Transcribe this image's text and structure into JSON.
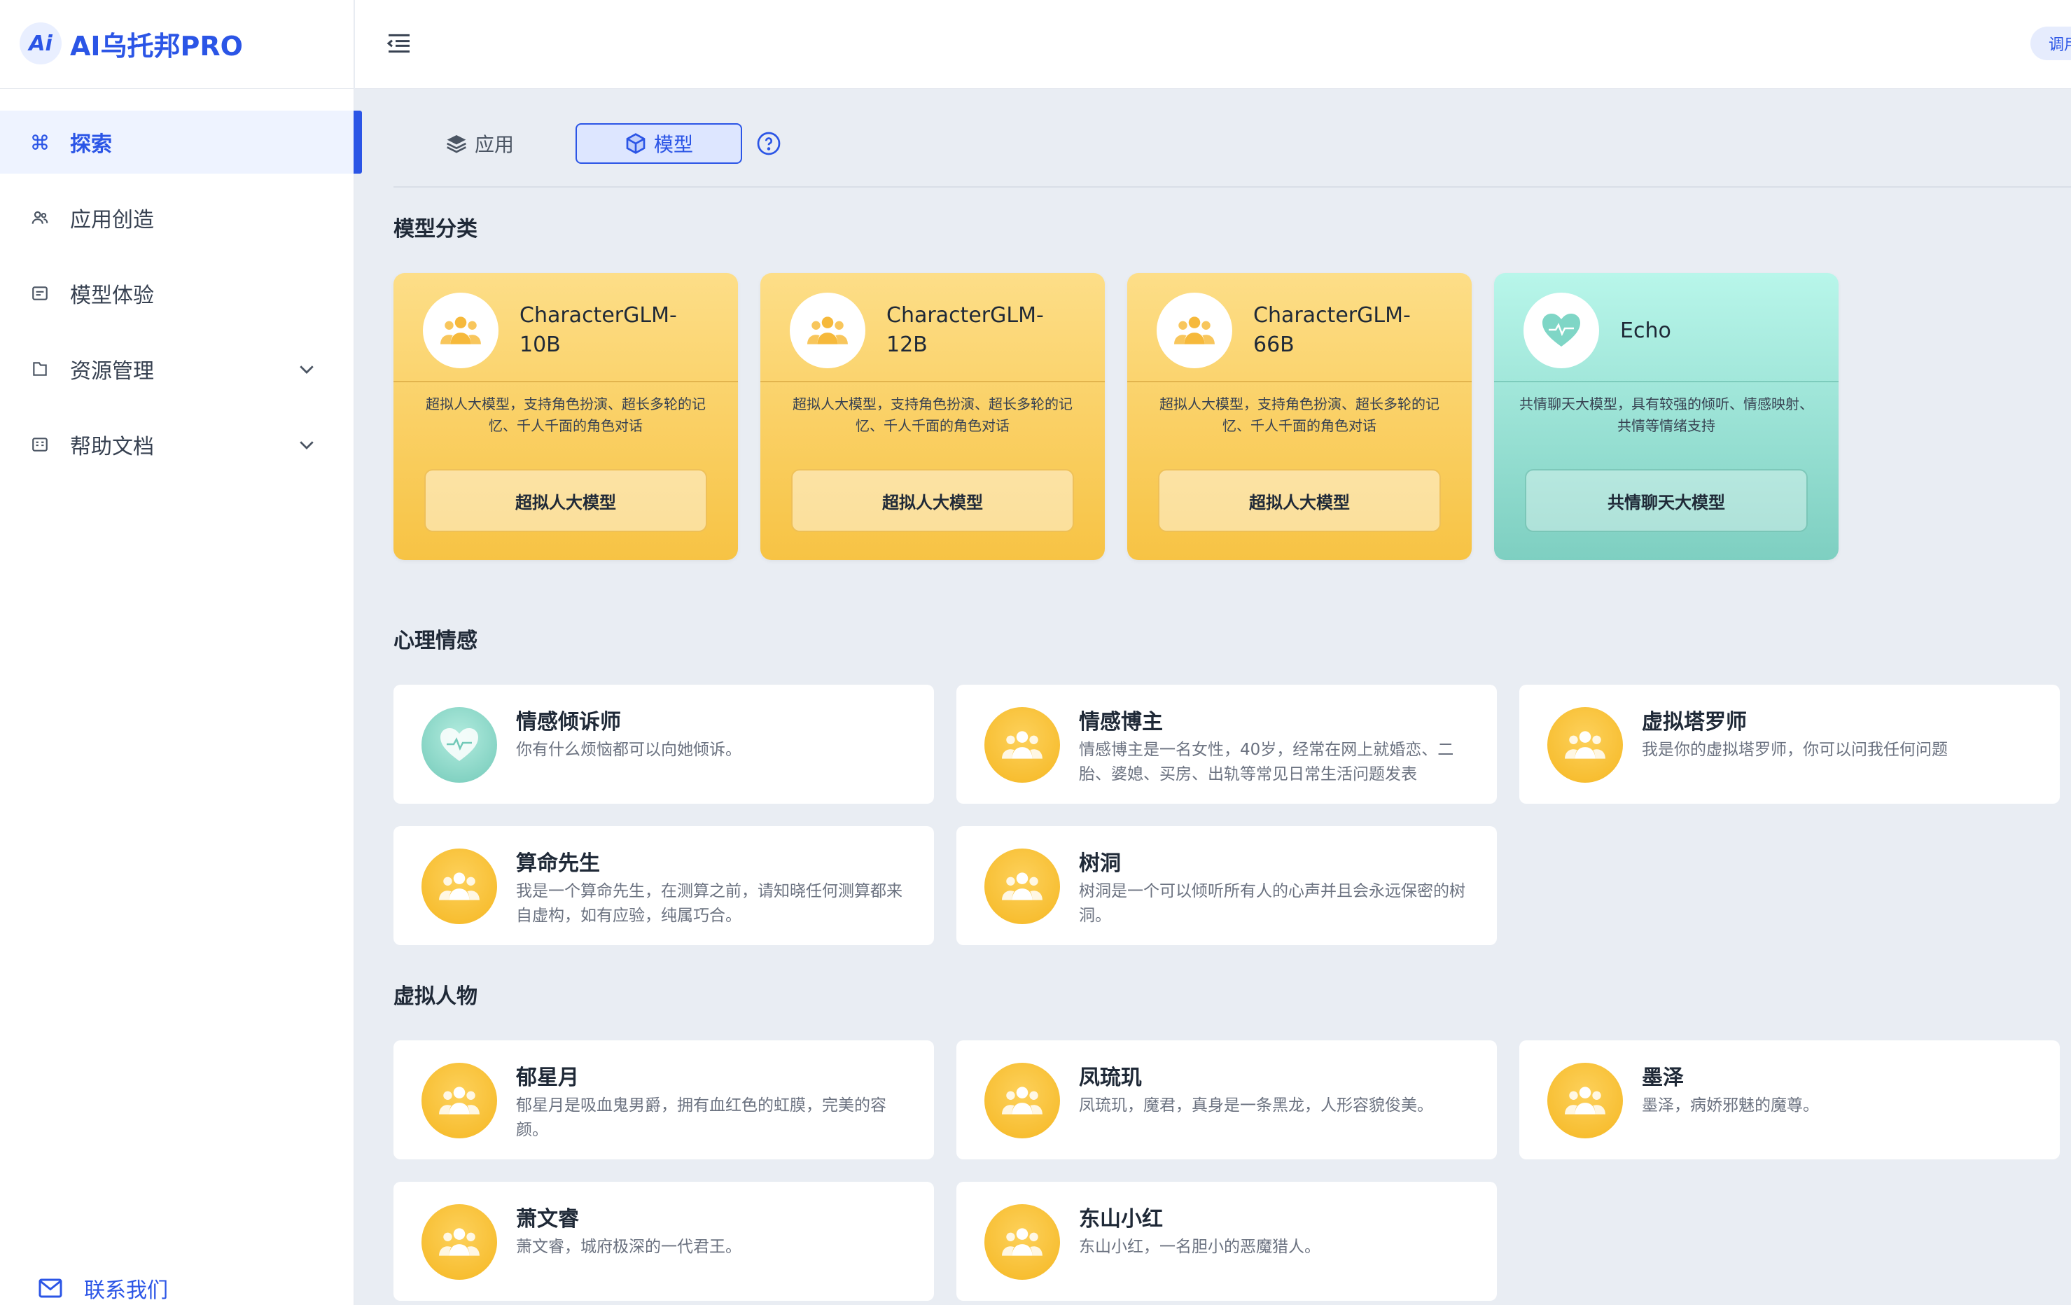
{
  "app": {
    "logo_mark": "Ai",
    "title": "AI乌托邦PRO"
  },
  "sidebar": {
    "items": [
      {
        "label": "探索",
        "icon": "command-icon",
        "active": true
      },
      {
        "label": "应用创造",
        "icon": "users-icon"
      },
      {
        "label": "模型体验",
        "icon": "message-square-icon"
      },
      {
        "label": "资源管理",
        "icon": "folder-icon",
        "expandable": true
      },
      {
        "label": "帮助文档",
        "icon": "book-icon",
        "expandable": true
      }
    ],
    "contact": {
      "label": "联系我们",
      "icon": "mail-icon"
    }
  },
  "header": {
    "right_pill": "调用"
  },
  "tabs": [
    {
      "label": "应用",
      "icon": "layers-icon"
    },
    {
      "label": "模型",
      "icon": "cube-icon",
      "selected": true
    }
  ],
  "colors": {
    "accent": "#2b55e6",
    "gold": "#f7c344",
    "teal": "#7ecfc1"
  },
  "sections": {
    "models": {
      "title": "模型分类",
      "cards": [
        {
          "name_line1": "CharacterGLM-",
          "name_line2": "10B",
          "desc": "超拟人大模型，支持角色扮演、超长多轮的记忆、千人千面的角色对话",
          "button": "超拟人大模型",
          "theme": "gold",
          "icon": "group-icon"
        },
        {
          "name_line1": "CharacterGLM-",
          "name_line2": "12B",
          "desc": "超拟人大模型，支持角色扮演、超长多轮的记忆、千人千面的角色对话",
          "button": "超拟人大模型",
          "theme": "gold",
          "icon": "group-icon"
        },
        {
          "name_line1": "CharacterGLM-",
          "name_line2": "66B",
          "desc": "超拟人大模型，支持角色扮演、超长多轮的记忆、千人千面的角色对话",
          "button": "超拟人大模型",
          "theme": "gold",
          "icon": "group-icon"
        },
        {
          "name_line1": "Echo",
          "name_line2": "",
          "desc": "共情聊天大模型，具有较强的倾听、情感映射、共情等情绪支持",
          "button": "共情聊天大模型",
          "theme": "teal",
          "icon": "heart-pulse-icon"
        }
      ]
    },
    "emotion": {
      "title": "心理情感",
      "cards": [
        {
          "name": "情感倾诉师",
          "desc": "你有什么烦恼都可以向她倾诉。",
          "theme": "teal"
        },
        {
          "name": "情感博主",
          "desc": "情感博主是一名女性，40岁，经常在网上就婚恋、二胎、婆媳、买房、出轨等常见日常生活问题发表",
          "theme": "gold"
        },
        {
          "name": "虚拟塔罗师",
          "desc": "我是你的虚拟塔罗师，你可以问我任何问题",
          "theme": "gold"
        },
        {
          "name": "算命先生",
          "desc": "我是一个算命先生，在测算之前，请知晓任何测算都来自虚构，如有应验，纯属巧合。",
          "theme": "gold"
        },
        {
          "name": "树洞",
          "desc": "树洞是一个可以倾听所有人的心声并且会永远保密的树洞。",
          "theme": "gold"
        }
      ]
    },
    "virtual": {
      "title": "虚拟人物",
      "cards": [
        {
          "name": "郁星月",
          "desc": "郁星月是吸血鬼男爵，拥有血红色的虹膜，完美的容颜。",
          "theme": "gold"
        },
        {
          "name": "凤琉玑",
          "desc": "凤琉玑，魔君，真身是一条黑龙，人形容貌俊美。",
          "theme": "gold"
        },
        {
          "name": "墨泽",
          "desc": "墨泽，病娇邪魅的魔尊。",
          "theme": "gold"
        },
        {
          "name": "萧文睿",
          "desc": "萧文睿，城府极深的一代君王。",
          "theme": "gold"
        },
        {
          "name": "东山小红",
          "desc": "东山小红，一名胆小的恶魔猎人。",
          "theme": "gold"
        }
      ]
    }
  }
}
